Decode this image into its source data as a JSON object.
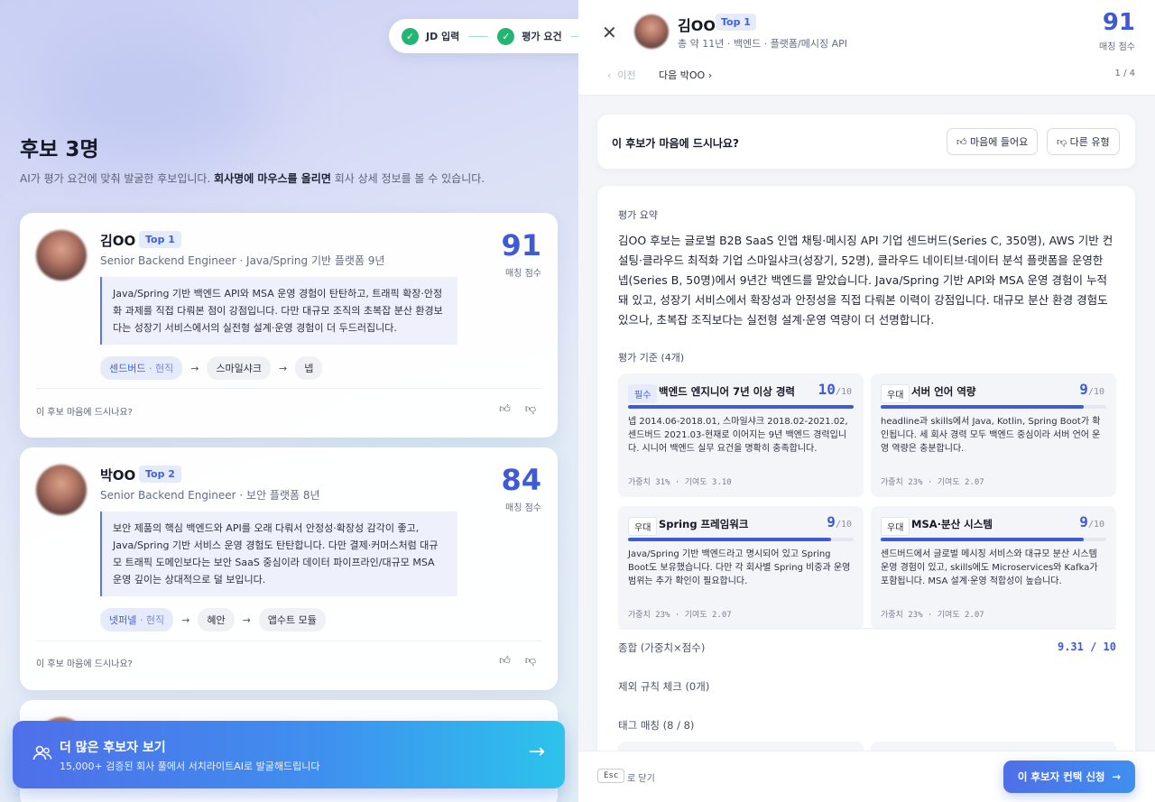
{
  "stepper": {
    "steps": [
      "JD 입력",
      "평가 요건"
    ]
  },
  "list": {
    "title": "후보 3명",
    "subtitle_pre": "AI가 평가 요건에 맞춰 발굴한 후보입니다. ",
    "subtitle_bold": "회사명에 마우스를 올리면",
    "subtitle_post": " 회사 상세 정보를 볼 수 있습니다.",
    "candidates": [
      {
        "name": "김OO",
        "badge": "Top 1",
        "role": "Senior Backend Engineer · Java/Spring 기반 플랫폼 9년",
        "score": "91",
        "score_label": "매칭 점수",
        "quote": "Java/Spring 기반 백엔드 API와 MSA 운영 경험이 탄탄하고, 트래픽 확장·안정화 과제를 직접 다뤄본 점이 강점입니다. 다만 대규모 조직의 초복잡 분산 환경보다는 성장기 서비스에서의 실전형 설계·운영 경험이 더 두드러집니다.",
        "current_company": "센드버드",
        "current_tag": "· 현직",
        "companies": [
          "스마일샤크",
          "넵"
        ],
        "prompt": "이 후보 마음에 드시나요?"
      },
      {
        "name": "박OO",
        "badge": "Top 2",
        "role": "Senior Backend Engineer · 보안 플랫폼 8년",
        "score": "84",
        "score_label": "매칭 점수",
        "quote": "보안 제품의 핵심 백엔드와 API를 오래 다뤄서 안정성·확장성 감각이 좋고, Java/Spring 기반 서비스 운영 경험도 탄탄합니다. 다만 결제·커머스처럼 대규모 트래픽 도메인보다는 보안 SaaS 중심이라 데이터 파이프라인/대규모 MSA 운영 깊이는 상대적으로 덜 보입니다.",
        "current_company": "넷퍼넬",
        "current_tag": "· 현직",
        "companies": [
          "혜안",
          "앱수트 모듈"
        ],
        "prompt": "이 후보 마음에 드시나요?"
      }
    ]
  },
  "cta": {
    "title": "더 많은 후보자 보기",
    "subtitle": "15,000+ 검증된 회사 풀에서 서치라이트AI로 발굴해드립니다"
  },
  "detail": {
    "name": "김OO",
    "badge": "Top 1",
    "meta": "총 약 11년 · 백엔드 · 플랫폼/메시징 API",
    "score": "91",
    "score_label": "매칭 점수",
    "prev": "이전",
    "next": "다음 박OO",
    "pager": "1 / 4",
    "like_question": "이 후보가 마음에 드시나요?",
    "like_btn": "마음에 들어요",
    "dislike_btn": "다른 유형",
    "summary_label": "평가 요약",
    "summary": "김OO 후보는 글로벌 B2B SaaS 인앱 채팅·메시징 API 기업 센드버드(Series C, 350명), AWS 기반 컨설팅·클라우드 최적화 기업 스마일샤크(성장기, 52명), 클라우드 네이티브·데이터 분석 플랫폼을 운영한 넵(Series B, 50명)에서 9년간 백엔드를 맡았습니다. Java/Spring 기반 API와 MSA 운영 경험이 누적돼 있고, 성장기 서비스에서 확장성과 안정성을 직접 다뤄본 이력이 강점입니다. 대규모 분산 환경 경험도 있으나, 초복잡 조직보다는 실전형 설계·운영 역량이 더 선명합니다.",
    "criteria_label": "평가 기준 (4개)",
    "criteria": [
      {
        "tag": "필수",
        "required": true,
        "name": "백엔드 엔지니어 7년 이상 경력",
        "score": 10,
        "max": "/10",
        "fill": 1.0,
        "desc": "넵 2014.06-2018.01, 스마일샤크 2018.02-2021.02, 센드버드 2021.03-현재로 이어지는 9년 백엔드 경력입니다. 시니어 백엔드 실무 요건을 명확히 충족합니다.",
        "meta": "가중치 31% · 기여도 3.10"
      },
      {
        "tag": "우대",
        "required": false,
        "name": "서버 언어 역량",
        "score": 9,
        "max": "/10",
        "fill": 0.9,
        "desc": "headline과 skills에서 Java, Kotlin, Spring Boot가 확인됩니다. 세 회사 경력 모두 백엔드 중심이라 서버 언어 운영 역량은 충분합니다.",
        "meta": "가중치 23% · 기여도 2.07"
      },
      {
        "tag": "우대",
        "required": false,
        "name": "Spring 프레임워크",
        "score": 9,
        "max": "/10",
        "fill": 0.9,
        "desc": "Java/Spring 기반 백엔드라고 명시되어 있고 Spring Boot도 보유했습니다. 다만 각 회사별 Spring 비중과 운영 범위는 추가 확인이 필요합니다.",
        "meta": "가중치 23% · 기여도 2.07"
      },
      {
        "tag": "우대",
        "required": false,
        "name": "MSA·분산 시스템",
        "score": 9,
        "max": "/10",
        "fill": 0.9,
        "desc": "센드버드에서 글로벌 메시징 서비스와 대규모 분산 시스템 운영 경험이 있고, skills에도 Microservices와 Kafka가 포함됩니다. MSA 설계·운영 적합성이 높습니다.",
        "meta": "가중치 23% · 기여도 2.07"
      }
    ],
    "total_label": "종합 (가중치×점수)",
    "total_value": "9.31 / 10",
    "exclusion_label": "제외 규칙 체크 (0개)",
    "tag_label": "태그 매칭 (8 / 8)",
    "esc_key": "Esc",
    "esc_text": "로 닫기",
    "contact": "이 후보자 컨택 신청"
  }
}
